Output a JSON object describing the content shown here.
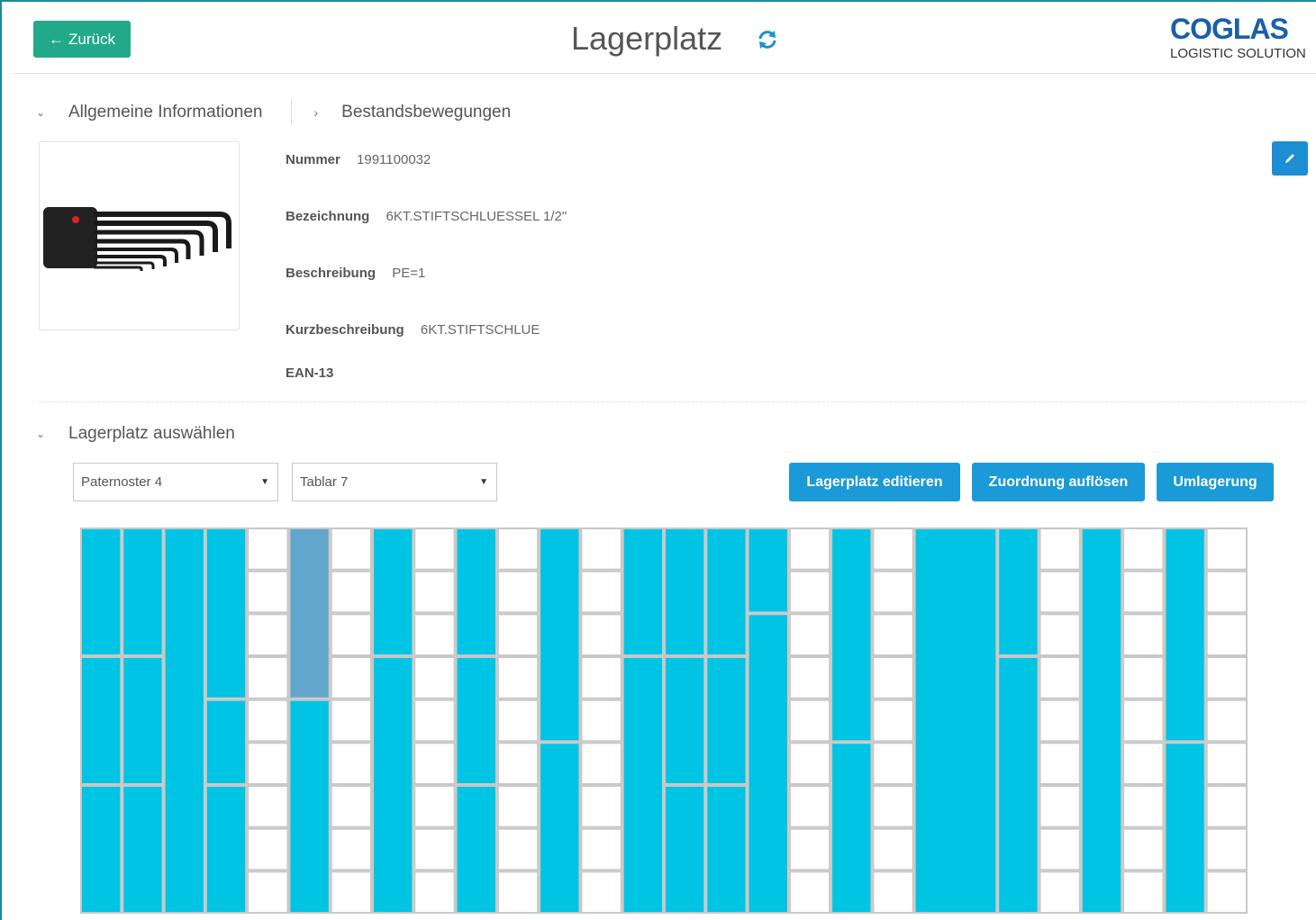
{
  "header": {
    "back_label": "Zurück",
    "title": "Lagerplatz",
    "logo_brand": "COGLAS",
    "logo_tagline": "LOGISTIC SOLUTION"
  },
  "tabs": {
    "general": "Allgemeine Informationen",
    "movements": "Bestandsbewegungen"
  },
  "article": {
    "nummer_label": "Nummer",
    "nummer_value": "1991100032",
    "bezeichnung_label": "Bezeichnung",
    "bezeichnung_value": "6KT.STIFTSCHLUESSEL 1/2\"",
    "beschreibung_label": "Beschreibung",
    "beschreibung_value": "PE=1",
    "kurz_label": "Kurzbeschreibung",
    "kurz_value": "6KT.STIFTSCHLUE",
    "ean_label": "EAN-13",
    "ean_value": ""
  },
  "storage": {
    "section_title": "Lagerplatz auswählen",
    "paternoster_value": "Paternoster 4",
    "tablar_value": "Tablar 7",
    "btn_edit": "Lagerplatz editieren",
    "btn_resolve": "Zuordnung auflösen",
    "btn_relocate": "Umlagerung"
  },
  "colors": {
    "accent_green": "#21a98a",
    "accent_blue": "#1a9ad6",
    "occupied": "#00c4e3",
    "selected": "#63a6cc",
    "empty": "#ffffff",
    "grid_line": "#c8c8c8"
  },
  "grid": {
    "columns": 28,
    "rows": 9,
    "cells": [
      {
        "c": 0,
        "r": 0,
        "cs": 1,
        "rs": 3,
        "s": "occupied"
      },
      {
        "c": 0,
        "r": 3,
        "cs": 1,
        "rs": 3,
        "s": "occupied"
      },
      {
        "c": 0,
        "r": 6,
        "cs": 1,
        "rs": 3,
        "s": "occupied"
      },
      {
        "c": 1,
        "r": 0,
        "cs": 1,
        "rs": 3,
        "s": "occupied"
      },
      {
        "c": 1,
        "r": 3,
        "cs": 1,
        "rs": 3,
        "s": "occupied"
      },
      {
        "c": 1,
        "r": 6,
        "cs": 1,
        "rs": 3,
        "s": "occupied"
      },
      {
        "c": 2,
        "r": 0,
        "cs": 1,
        "rs": 9,
        "s": "occupied"
      },
      {
        "c": 3,
        "r": 0,
        "cs": 1,
        "rs": 4,
        "s": "occupied"
      },
      {
        "c": 3,
        "r": 4,
        "cs": 1,
        "rs": 2,
        "s": "occupied"
      },
      {
        "c": 3,
        "r": 6,
        "cs": 1,
        "rs": 3,
        "s": "occupied"
      },
      {
        "c": 5,
        "r": 0,
        "cs": 1,
        "rs": 4,
        "s": "selected"
      },
      {
        "c": 5,
        "r": 4,
        "cs": 1,
        "rs": 5,
        "s": "occupied"
      },
      {
        "c": 7,
        "r": 0,
        "cs": 1,
        "rs": 3,
        "s": "occupied"
      },
      {
        "c": 7,
        "r": 3,
        "cs": 1,
        "rs": 6,
        "s": "occupied"
      },
      {
        "c": 9,
        "r": 0,
        "cs": 1,
        "rs": 3,
        "s": "occupied"
      },
      {
        "c": 9,
        "r": 3,
        "cs": 1,
        "rs": 3,
        "s": "occupied"
      },
      {
        "c": 9,
        "r": 6,
        "cs": 1,
        "rs": 3,
        "s": "occupied"
      },
      {
        "c": 11,
        "r": 0,
        "cs": 1,
        "rs": 5,
        "s": "occupied"
      },
      {
        "c": 11,
        "r": 5,
        "cs": 1,
        "rs": 4,
        "s": "occupied"
      },
      {
        "c": 13,
        "r": 0,
        "cs": 1,
        "rs": 3,
        "s": "occupied"
      },
      {
        "c": 13,
        "r": 3,
        "cs": 1,
        "rs": 6,
        "s": "occupied"
      },
      {
        "c": 14,
        "r": 0,
        "cs": 1,
        "rs": 3,
        "s": "occupied"
      },
      {
        "c": 14,
        "r": 3,
        "cs": 1,
        "rs": 3,
        "s": "occupied"
      },
      {
        "c": 14,
        "r": 6,
        "cs": 1,
        "rs": 3,
        "s": "occupied"
      },
      {
        "c": 15,
        "r": 0,
        "cs": 1,
        "rs": 3,
        "s": "occupied"
      },
      {
        "c": 15,
        "r": 3,
        "cs": 1,
        "rs": 3,
        "s": "occupied"
      },
      {
        "c": 15,
        "r": 6,
        "cs": 1,
        "rs": 3,
        "s": "occupied"
      },
      {
        "c": 16,
        "r": 0,
        "cs": 1,
        "rs": 2,
        "s": "occupied"
      },
      {
        "c": 16,
        "r": 2,
        "cs": 1,
        "rs": 7,
        "s": "occupied"
      },
      {
        "c": 18,
        "r": 0,
        "cs": 1,
        "rs": 5,
        "s": "occupied"
      },
      {
        "c": 18,
        "r": 5,
        "cs": 1,
        "rs": 4,
        "s": "occupied"
      },
      {
        "c": 20,
        "r": 0,
        "cs": 2,
        "rs": 9,
        "s": "occupied"
      },
      {
        "c": 22,
        "r": 0,
        "cs": 1,
        "rs": 3,
        "s": "occupied"
      },
      {
        "c": 22,
        "r": 3,
        "cs": 1,
        "rs": 6,
        "s": "occupied"
      },
      {
        "c": 24,
        "r": 0,
        "cs": 1,
        "rs": 9,
        "s": "occupied"
      },
      {
        "c": 26,
        "r": 0,
        "cs": 1,
        "rs": 5,
        "s": "occupied"
      },
      {
        "c": 26,
        "r": 5,
        "cs": 1,
        "rs": 4,
        "s": "occupied"
      }
    ],
    "empty_columns": [
      4,
      6,
      8,
      10,
      12,
      17,
      19,
      23,
      25,
      27
    ]
  }
}
